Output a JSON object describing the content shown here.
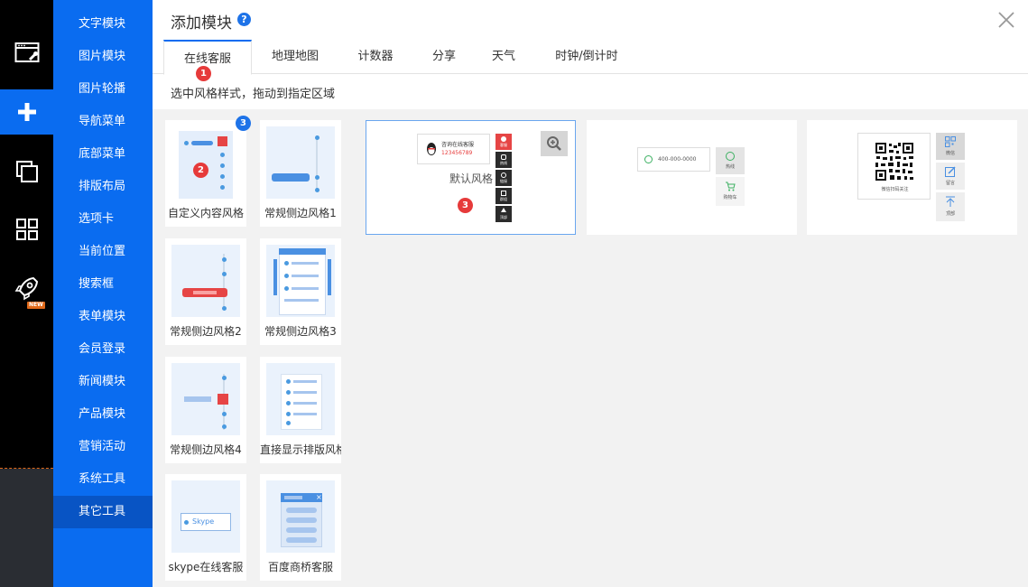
{
  "rail": {
    "items": [
      {
        "icon": "browser-settings-icon"
      },
      {
        "icon": "plus-icon",
        "active": true
      },
      {
        "icon": "copy-pages-icon"
      },
      {
        "icon": "grid-apps-icon"
      },
      {
        "icon": "rocket-icon",
        "badge": "NEW"
      }
    ]
  },
  "menu": {
    "items": [
      {
        "label": "文字模块"
      },
      {
        "label": "图片模块"
      },
      {
        "label": "图片轮播"
      },
      {
        "label": "导航菜单"
      },
      {
        "label": "底部菜单"
      },
      {
        "label": "排版布局"
      },
      {
        "label": "选项卡"
      },
      {
        "label": "当前位置"
      },
      {
        "label": "搜索框"
      },
      {
        "label": "表单模块"
      },
      {
        "label": "会员登录"
      },
      {
        "label": "新闻模块"
      },
      {
        "label": "产品模块"
      },
      {
        "label": "营销活动"
      },
      {
        "label": "系统工具"
      },
      {
        "label": "其它工具",
        "active": true
      }
    ]
  },
  "dialog": {
    "title": "添加模块",
    "help_icon": "?",
    "hint": "选中风格样式，拖动到指定区域"
  },
  "tabs": [
    {
      "label": "在线客服",
      "active": true
    },
    {
      "label": "地理地图"
    },
    {
      "label": "计数器"
    },
    {
      "label": "分享"
    },
    {
      "label": "天气"
    },
    {
      "label": "时钟/倒计时"
    }
  ],
  "modules": [
    {
      "label": "自定义内容风格"
    },
    {
      "label": "常规侧边风格1"
    },
    {
      "label": "常规侧边风格2"
    },
    {
      "label": "常规侧边风格3"
    },
    {
      "label": "常规侧边风格4"
    },
    {
      "label": "直接显示排版风格"
    },
    {
      "label": "skype在线客服",
      "inner_text": "Skype"
    },
    {
      "label": "百度商桥客服"
    }
  ],
  "styles": [
    {
      "label": "默认风格",
      "selected": true,
      "qq_title": "咨询在线客服",
      "qq_number": "123456789",
      "buttons": [
        "客服",
        "热线",
        "链接",
        "群组",
        "顶部"
      ]
    },
    {
      "phone": "400-000-0000",
      "buttons": [
        "热线",
        "购物车"
      ]
    },
    {
      "qr_caption": "微信扫码关注",
      "buttons": [
        "微信",
        "留言",
        "顶部"
      ]
    }
  ],
  "badges": {
    "tab": "1",
    "module": "2",
    "module_count": "3",
    "style": "3"
  },
  "colors": {
    "accent": "#0a6cf0",
    "rail": "#000000",
    "badge_red": "#e63a3a",
    "badge_blue": "#1e73e8",
    "new_badge": "#e0691a"
  }
}
